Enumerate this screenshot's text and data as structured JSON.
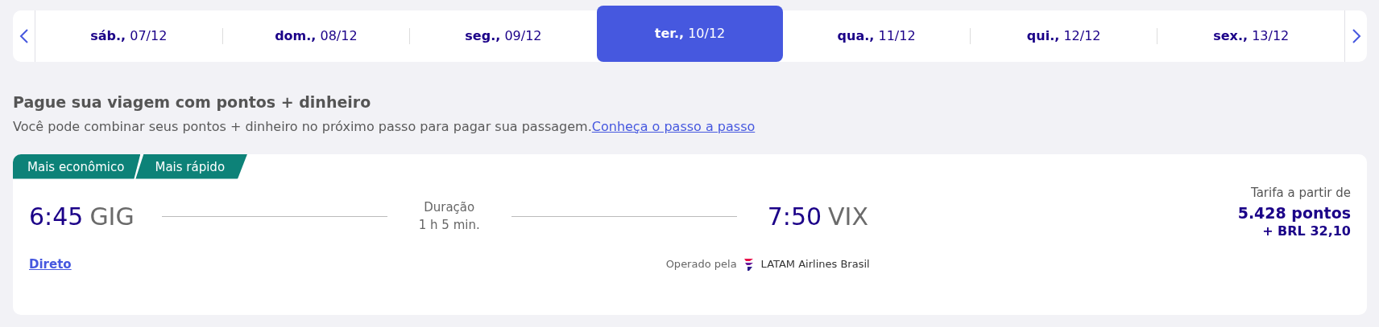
{
  "date_bar": {
    "dates": [
      {
        "label": "**sáb.,** 07/12",
        "selected": false
      },
      {
        "label": "**dom.,** 08/12",
        "selected": false
      },
      {
        "label": "**seg.,** 09/12",
        "selected": false
      },
      {
        "label": "**ter.,** 10/12",
        "selected": true
      },
      {
        "label": "**qua.,** 11/12",
        "selected": false
      },
      {
        "label": "**qui.,** 12/12",
        "selected": false
      },
      {
        "label": "**sex.,** 13/12",
        "selected": false
      }
    ]
  },
  "promo": {
    "title": "Pague sua viagem com pontos + dinheiro",
    "text": "Você pode combinar seus pontos + dinheiro no próximo passo para pagar sua passagem.",
    "link": "Conheça o passo a passo"
  },
  "flight": {
    "tags": [
      "Mais econômico",
      "Mais rápido"
    ],
    "departure": {
      "time": "6:45",
      "airport": "GIG"
    },
    "duration_label": "Duração",
    "duration": "1 h 5 min.",
    "arrival": {
      "time": "7:50",
      "airport": "VIX"
    },
    "fare_label": "Tarifa a partir de",
    "points": "5.428 pontos",
    "cash": "+ BRL 32,10",
    "stops": "Direto",
    "operated_label": "Operado pela",
    "airline": "LATAM Airlines Brasil"
  }
}
